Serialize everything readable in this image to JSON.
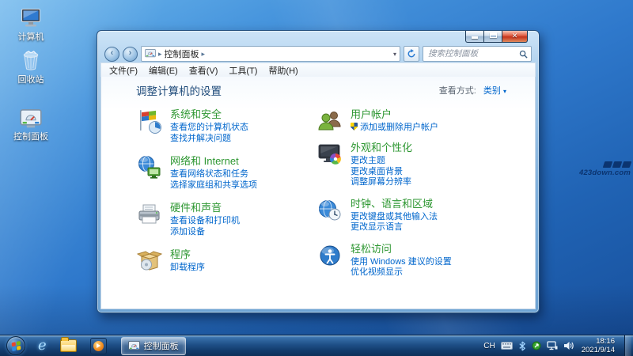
{
  "theme": {
    "desktop_blue": "#2f79cc",
    "category_title_green": "#2e9732",
    "task_link_blue": "#0066cc",
    "heading_blue": "#1e4a79",
    "close_button_red": "#c5341c"
  },
  "desktop": {
    "icons": [
      {
        "label": "计算机",
        "icon": "computer-icon"
      },
      {
        "label": "回收站",
        "icon": "recycle-bin-icon"
      },
      {
        "label": "控制面板",
        "icon": "control-panel-icon"
      }
    ],
    "watermark": "423down.com"
  },
  "window": {
    "navbar": {
      "breadcrumb": "控制面板",
      "search_placeholder": "搜索控制面板"
    },
    "menubar": {
      "items": [
        "文件(F)",
        "编辑(E)",
        "查看(V)",
        "工具(T)",
        "帮助(H)"
      ]
    },
    "header": {
      "title": "调整计算机的设置",
      "view_label": "查看方式:",
      "view_value": "类别"
    },
    "columns": {
      "left": [
        {
          "title": "系统和安全",
          "icon": "system-security-icon",
          "links": [
            "查看您的计算机状态",
            "查找并解决问题"
          ]
        },
        {
          "title": "网络和 Internet",
          "icon": "network-internet-icon",
          "links": [
            "查看网络状态和任务",
            "选择家庭组和共享选项"
          ]
        },
        {
          "title": "硬件和声音",
          "icon": "hardware-sound-icon",
          "links": [
            "查看设备和打印机",
            "添加设备"
          ]
        },
        {
          "title": "程序",
          "icon": "programs-icon",
          "links": [
            "卸载程序"
          ]
        }
      ],
      "right": [
        {
          "title": "用户帐户",
          "icon": "user-accounts-icon",
          "links": [
            "添加或删除用户帐户"
          ],
          "first_link_has_uac_shield": true
        },
        {
          "title": "外观和个性化",
          "icon": "appearance-personalization-icon",
          "links": [
            "更改主题",
            "更改桌面背景",
            "调整屏幕分辨率"
          ]
        },
        {
          "title": "时钟、语言和区域",
          "icon": "clock-language-region-icon",
          "links": [
            "更改键盘或其他输入法",
            "更改显示语言"
          ]
        },
        {
          "title": "轻松访问",
          "icon": "ease-of-access-icon",
          "links": [
            "使用 Windows 建议的设置",
            "优化视频显示"
          ]
        }
      ]
    }
  },
  "taskbar": {
    "active_button": {
      "label": "控制面板"
    },
    "tray": {
      "language": "CH",
      "time": "18:16",
      "date": "2021/9/14"
    }
  }
}
